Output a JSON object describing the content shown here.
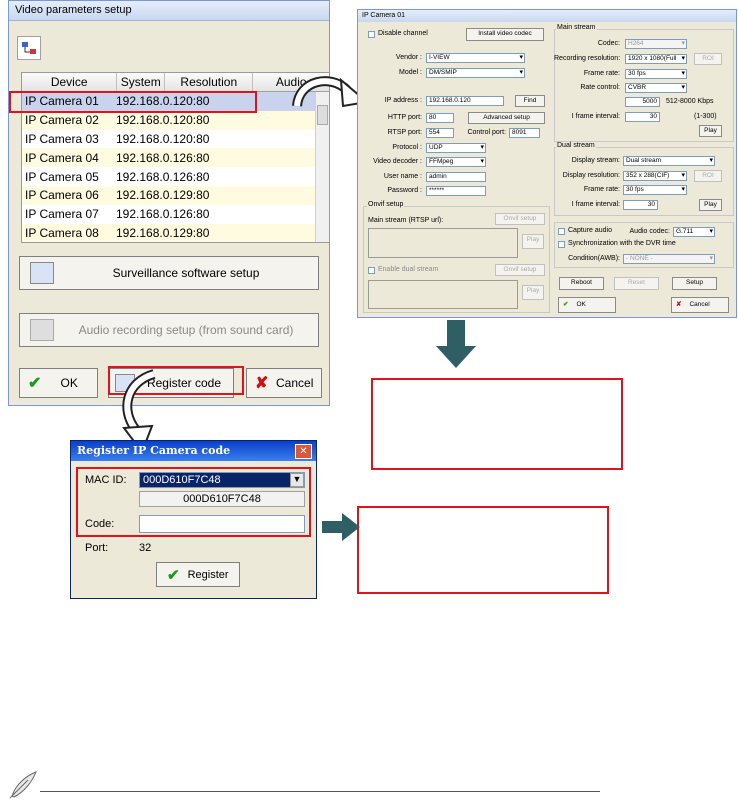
{
  "win1": {
    "title": "Video parameters setup",
    "columns": [
      "Device",
      "System",
      "Resolution",
      "Audio"
    ],
    "rows": [
      {
        "device": "IP Camera 01",
        "system": "192.168.0.120:80"
      },
      {
        "device": "IP Camera 02",
        "system": "192.168.0.120:80"
      },
      {
        "device": "IP Camera 03",
        "system": "192.168.0.120:80"
      },
      {
        "device": "IP Camera 04",
        "system": "192.168.0.126:80"
      },
      {
        "device": "IP Camera 05",
        "system": "192.168.0.126:80"
      },
      {
        "device": "IP Camera 06",
        "system": "192.168.0.129:80"
      },
      {
        "device": "IP Camera 07",
        "system": "192.168.0.126:80"
      },
      {
        "device": "IP Camera 08",
        "system": "192.168.0.129:80"
      }
    ],
    "surveillance_btn": "Surveillance software setup",
    "audio_btn": "Audio recording setup (from sound card)",
    "ok_btn": "OK",
    "register_btn": "Register code",
    "cancel_btn": "Cancel"
  },
  "win2": {
    "title": "IP Camera 01",
    "disable_channel": "Disable channel",
    "install_codec": "Install video codec",
    "vendor_label": "Vendor :",
    "vendor_value": "I-VIEW",
    "model_label": "Model :",
    "model_value": "DM/SMIP",
    "ip_label": "IP address :",
    "ip_value": "192.168.0.120",
    "find_btn": "Find",
    "http_label": "HTTP port:",
    "http_value": "80",
    "advanced_btn": "Advanced setup",
    "rtsp_label": "RTSP port:",
    "rtsp_value": "554",
    "control_label": "Control port:",
    "control_value": "8091",
    "protocol_label": "Protocol :",
    "protocol_value": "UDP",
    "decoder_label": "Video decoder :",
    "decoder_value": "FFMpeg",
    "user_label": "User name :",
    "user_value": "admin",
    "pass_label": "Password :",
    "pass_value": "******",
    "onvif_title": "Onvif setup",
    "main_rtsp": "Main stream (RTSP url):",
    "onvif_setup": "Onvif setup",
    "play": "Play",
    "enable_dual": "Enable dual stream",
    "main_stream_title": "Main stream",
    "codec_label": "Codec:",
    "codec_value": "H264",
    "rec_res_label": "Recording resolution:",
    "rec_res_value": "1920 x 1080(Full",
    "roi": "ROI",
    "frame_rate_label": "Frame rate:",
    "frame_rate_value": "30 fps",
    "rate_ctrl_label": "Rate control:",
    "rate_ctrl_value": "CVBR",
    "kbps_value": "5000",
    "kbps_range": "512-8000 Kbps",
    "iframe_label": "I frame interval:",
    "iframe_value": "30",
    "iframe_range": "(1-300)",
    "dual_stream_title": "Dual stream",
    "disp_stream_label": "Display stream:",
    "disp_stream_value": "Dual stream",
    "disp_res_label": "Display resolution:",
    "disp_res_value": "352 x 288(CIF)",
    "dual_frame_value": "30 fps",
    "dual_iframe_value": "30",
    "capture_audio": "Capture audio",
    "audio_codec_label": "Audio codec:",
    "audio_codec_value": "G.711",
    "sync_dvr": "Synchronization with the DVR time",
    "condition_label": "Condition(AWB):",
    "condition_value": "- NONE -",
    "reboot_btn": "Reboot",
    "reset_btn": "Reset",
    "setup_btn": "Setup",
    "ok_btn": "OK",
    "cancel_btn": "Cancel"
  },
  "win3": {
    "title": "Register IP Camera code",
    "mac_label": "MAC ID:",
    "mac_value": "000D610F7C48",
    "mac_display": "000D610F7C48",
    "code_label": "Code:",
    "code_value": "",
    "port_label": "Port:",
    "port_value": "32",
    "register_btn": "Register"
  },
  "colors": {
    "highlight_red": "#e0131d",
    "arrow_dark": "#2f5f64",
    "xp_blue": "#0a3fc6"
  }
}
